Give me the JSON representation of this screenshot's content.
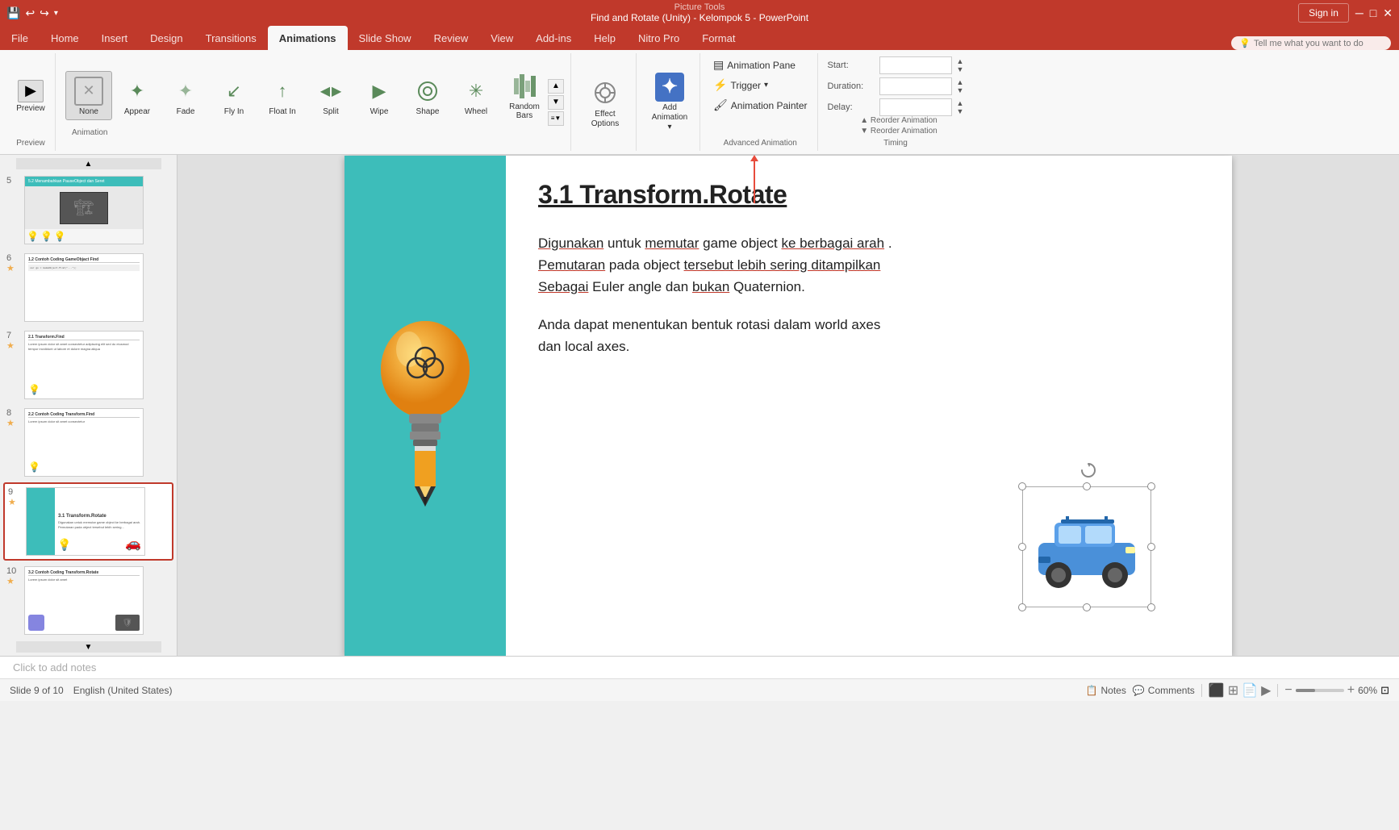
{
  "titleBar": {
    "title": "Find and Rotate (Unity) - Kelompok 5 - PowerPoint",
    "pictureTools": "Picture Tools",
    "signIn": "Sign in"
  },
  "quickAccess": {
    "save": "💾",
    "undo": "↩",
    "redo": "↪",
    "customize": "▾"
  },
  "ribbonTabs": [
    {
      "id": "file",
      "label": "File"
    },
    {
      "id": "home",
      "label": "Home"
    },
    {
      "id": "insert",
      "label": "Insert"
    },
    {
      "id": "design",
      "label": "Design"
    },
    {
      "id": "transitions",
      "label": "Transitions"
    },
    {
      "id": "animations",
      "label": "Animations",
      "active": true
    },
    {
      "id": "slideshow",
      "label": "Slide Show"
    },
    {
      "id": "review",
      "label": "Review"
    },
    {
      "id": "view",
      "label": "View"
    },
    {
      "id": "addins",
      "label": "Add-ins"
    },
    {
      "id": "help",
      "label": "Help"
    },
    {
      "id": "nitropro",
      "label": "Nitro Pro"
    },
    {
      "id": "format",
      "label": "Format"
    }
  ],
  "previewGroup": {
    "label": "Preview",
    "buttonLabel": "Preview"
  },
  "animationGallery": {
    "label": "Animation",
    "items": [
      {
        "id": "none",
        "label": "None",
        "active": true
      },
      {
        "id": "appear",
        "label": "Appear"
      },
      {
        "id": "fade",
        "label": "Fade"
      },
      {
        "id": "flyin",
        "label": "Fly In"
      },
      {
        "id": "floatin",
        "label": "Float In"
      },
      {
        "id": "split",
        "label": "Split"
      },
      {
        "id": "wipe",
        "label": "Wipe"
      },
      {
        "id": "shape",
        "label": "Shape"
      },
      {
        "id": "wheel",
        "label": "Wheel"
      },
      {
        "id": "randombars",
        "label": "Random Bars"
      }
    ]
  },
  "effectOptions": {
    "label": "Effect\nOptions",
    "icon": "⚙"
  },
  "addAnimation": {
    "label": "Add\nAnimation",
    "icon": "✦"
  },
  "advancedAnimation": {
    "label": "Advanced Animation",
    "animationPane": "Animation Pane",
    "trigger": "Trigger",
    "animationPainter": "Animation Painter"
  },
  "timing": {
    "label": "Timing",
    "startLabel": "Start:",
    "durationLabel": "Duration:",
    "delayLabel": "Delay:",
    "reorder1": "Reorder",
    "reorder2": "Animation"
  },
  "tellMe": {
    "placeholder": "Tell me what you want to do"
  },
  "slides": [
    {
      "num": 5,
      "star": false,
      "desc": "Slide 5"
    },
    {
      "num": 6,
      "star": true,
      "desc": "Slide 6"
    },
    {
      "num": 7,
      "star": true,
      "desc": "Slide 7"
    },
    {
      "num": 8,
      "star": true,
      "desc": "Slide 8"
    },
    {
      "num": 9,
      "star": true,
      "desc": "Slide 9",
      "active": true
    },
    {
      "num": 10,
      "star": true,
      "desc": "Slide 10"
    }
  ],
  "currentSlide": {
    "title": "3.1 Transform.Rotate",
    "body1": "Digunakan untuk memutar game object ke berbagai arah. Pemutaran pada object tersebut lebih sering ditampilkan Sebagai Euler angle dan bukan Quaternion.",
    "body2": "Anda dapat menentukan bentuk rotasi dalam world axes dan local axes.",
    "underlineWords": [
      "Digunakan",
      "memutar",
      "ke",
      "berbagai",
      "arah",
      "Pemutaran",
      "tersebut",
      "lebih",
      "sering",
      "ditampilkan",
      "Sebagai",
      "bukan"
    ]
  },
  "statusBar": {
    "slideInfo": "Slide 9 of 10",
    "language": "English (United States)"
  },
  "notesBar": {
    "placeholder": "Click to add notes"
  },
  "bottomBar": {
    "notes": "Notes",
    "comments": "Comments"
  }
}
